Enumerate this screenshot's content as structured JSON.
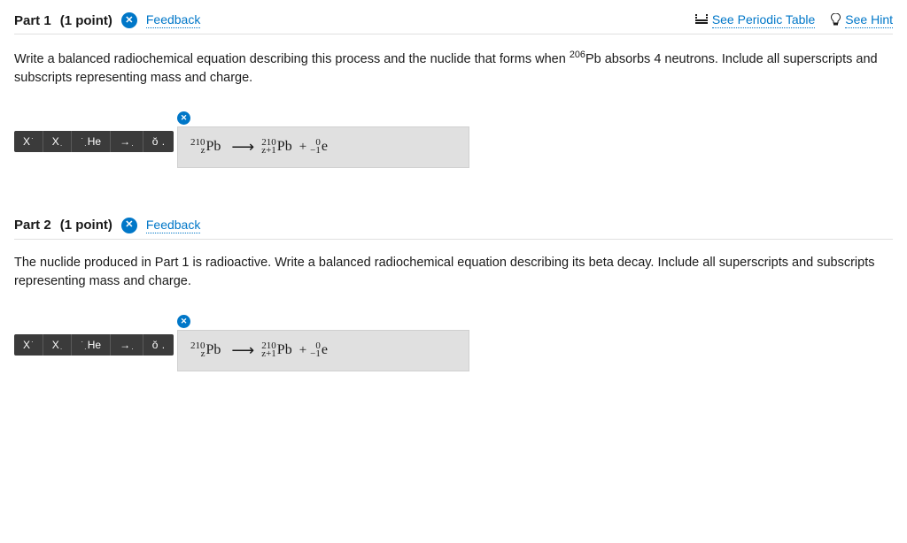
{
  "header_links": {
    "periodic_table": "See Periodic Table",
    "see_hint": "See Hint",
    "feedback": "Feedback"
  },
  "toolbar": {
    "btn_xsup": "X",
    "btn_xsub": "X",
    "btn_he": "He",
    "btn_arrow": "→",
    "btn_delta": "ŏ"
  },
  "part1": {
    "title": "Part 1",
    "points": "(1 point)",
    "question_before": "Write a balanced radiochemical equation describing this process and the nuclide that forms when ",
    "question_sup": "206",
    "question_element": "Pb",
    "question_after": " absorbs 4 neutrons. Include all superscripts and subscripts representing mass and charge.",
    "answer": {
      "lhs_mass": "210",
      "lhs_charge": "z",
      "lhs_sym": "Pb",
      "rhs1_mass": "210",
      "rhs1_charge": "z+1",
      "rhs1_sym": "Pb",
      "rhs2_mass": "0",
      "rhs2_charge": "−1",
      "rhs2_sym": "e"
    }
  },
  "part2": {
    "title": "Part 2",
    "points": "(1 point)",
    "question": "The nuclide produced in Part 1 is radioactive. Write a balanced radiochemical equation describing its beta decay. Include all superscripts and subscripts representing mass and charge.",
    "answer": {
      "lhs_mass": "210",
      "lhs_charge": "z",
      "lhs_sym": "Pb",
      "rhs1_mass": "210",
      "rhs1_charge": "z+1",
      "rhs1_sym": "Pb",
      "rhs2_mass": "0",
      "rhs2_charge": "−1",
      "rhs2_sym": "e"
    }
  }
}
